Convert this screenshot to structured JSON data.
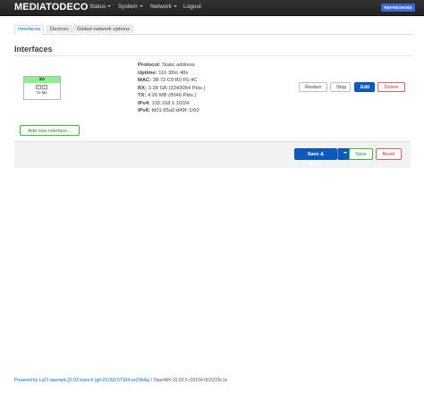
{
  "header": {
    "brand": "MEDIATODECO",
    "menu": [
      "Status",
      "System",
      "Network",
      "Logout"
    ],
    "badge": "REFRESHING"
  },
  "tabs": [
    "Interfaces",
    "Devices",
    "Global network options"
  ],
  "section_title": "Interfaces",
  "interface": {
    "name": "lan",
    "device": "br-lan",
    "info": [
      {
        "label": "Protocol:",
        "value": "Static address"
      },
      {
        "label": "Uptime:",
        "value": "11h 38m 48s"
      },
      {
        "label": "MAC:",
        "value": "38:72:C0:B0:F5:4C"
      },
      {
        "label": "RX:",
        "value": "3.28 GB (3343054 Pkts.)"
      },
      {
        "label": "TX:",
        "value": "4.26 MB (8546 Pkts.)"
      },
      {
        "label": "IPv4:",
        "value": "192.168.1.10/24"
      },
      {
        "label": "IPv6:",
        "value": "fd01:85a2:d49f::1/60"
      }
    ],
    "buttons": {
      "restart": "Restart",
      "stop": "Stop",
      "edit": "Edit",
      "delete": "Delete"
    }
  },
  "add_button": "Add new interface...",
  "actions": {
    "save_apply": "Save & Apply",
    "save": "Save",
    "reset": "Reset"
  },
  "footer": {
    "link": "Powered by LuCI openwrt-22.03 branch (git-23.093.57104-ce20b4a)",
    "rest": " / OpenWrt 22.03.5 r20134-5f15225c1e"
  },
  "colors": {
    "navbar": "#222222",
    "primary": "#0b5bbd",
    "positive": "#3ab53a",
    "negative": "#e06060",
    "iface": "#90f090"
  }
}
